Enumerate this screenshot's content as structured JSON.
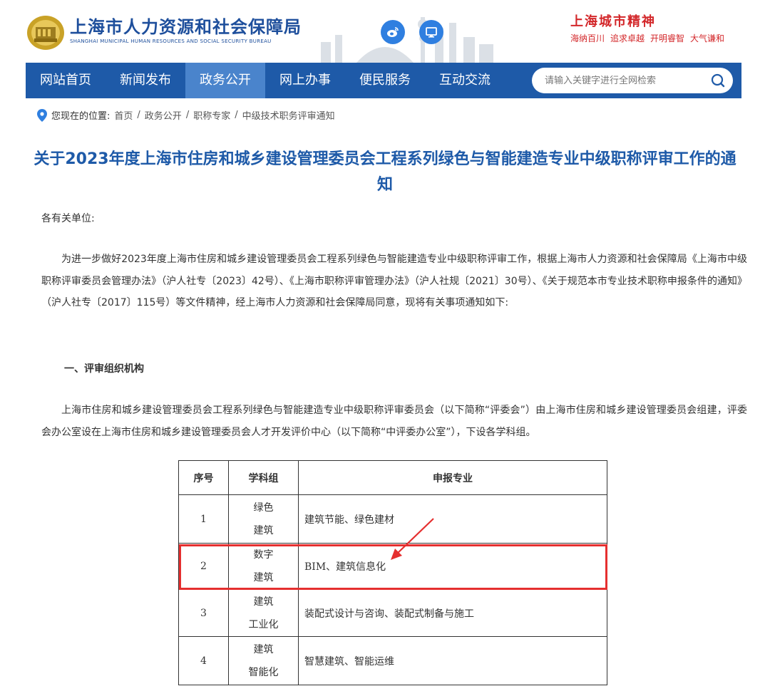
{
  "header": {
    "title": "上海市人力资源和社会保障局",
    "subtitle": "SHANGHAI MUNICIPAL HUMAN RESOURCES AND SOCIAL SECURITY BUREAU",
    "spirit_title": "上海城市精神",
    "spirit_words": [
      "海纳百川",
      "追求卓越",
      "开明睿智",
      "大气谦和"
    ],
    "icons": [
      "weibo-icon",
      "desktop-icon"
    ]
  },
  "nav": {
    "items": [
      "网站首页",
      "新闻发布",
      "政务公开",
      "网上办事",
      "便民服务",
      "互动交流"
    ],
    "active": "政务公开",
    "search_placeholder": "请输入关键字进行全网检索"
  },
  "breadcrumb": {
    "prefix": "您现在的位置:",
    "items": [
      "首页",
      "政务公开",
      "职称专家",
      "中级技术职务评审通知"
    ]
  },
  "article": {
    "title": "关于2023年度上海市住房和城乡建设管理委员会工程系列绿色与智能建造专业中级职称评审工作的通知",
    "salutation": "各有关单位:",
    "para1": "为进一步做好2023年度上海市住房和城乡建设管理委员会工程系列绿色与智能建造专业中级职称评审工作，根据上海市人力资源和社会保障局《上海市中级职称评审委员会管理办法》（沪人社专〔2023〕42号）、《上海市职称评审管理办法》（沪人社规〔2021〕30号）、《关于规范本市专业技术职称申报条件的通知》（沪人社专〔2017〕115号）等文件精神，经上海市人力资源和社会保障局同意，现将有关事项通知如下:",
    "section1": "一、评审组织机构",
    "para2": "上海市住房和城乡建设管理委员会工程系列绿色与智能建造专业中级职称评审委员会（以下简称“评委会”）由上海市住房和城乡建设管理委员会组建，评委会办公室设在上海市住房和城乡建设管理委员会人才开发评价中心（以下简称“中评委办公室”），下设各学科组。"
  },
  "table": {
    "headers": [
      "序号",
      "学科组",
      "申报专业"
    ],
    "rows": [
      {
        "no": "1",
        "group_line1": "绿色",
        "group_line2": "建筑",
        "spec": "建筑节能、绿色建材"
      },
      {
        "no": "2",
        "group_line1": "数字",
        "group_line2": "建筑",
        "spec": "BIM、建筑信息化"
      },
      {
        "no": "3",
        "group_line1": "建筑",
        "group_line2": "工业化",
        "spec": "装配式设计与咨询、装配式制备与施工"
      },
      {
        "no": "4",
        "group_line1": "建筑",
        "group_line2": "智能化",
        "spec": "智慧建筑、智能运维"
      }
    ],
    "highlighted_row": "2"
  },
  "colors": {
    "brand_blue": "#1e5aa8",
    "nav_active": "#4a84cc",
    "highlight_red": "#e52f2f",
    "spirit_red": "#d3272a"
  }
}
